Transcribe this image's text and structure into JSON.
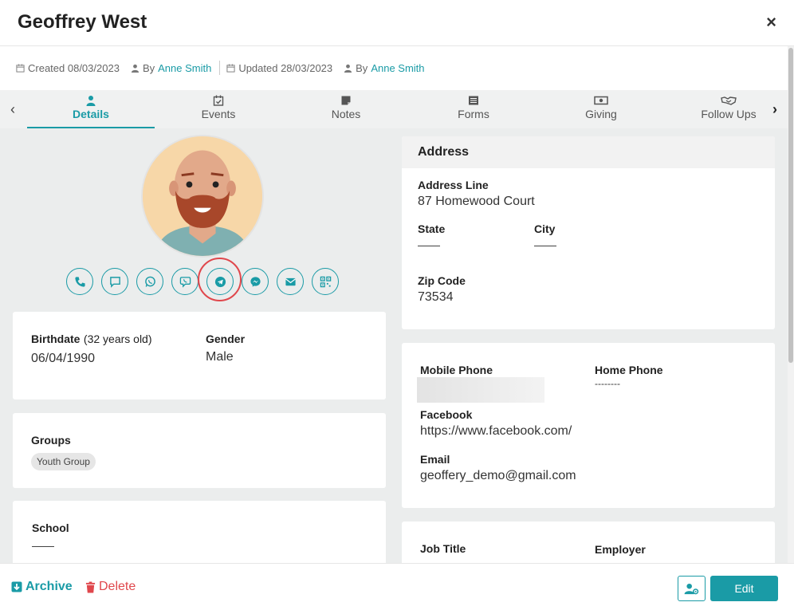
{
  "header": {
    "title": "Geoffrey West",
    "close_label": "×"
  },
  "meta": {
    "created": "Created 08/03/2023",
    "by1": "By",
    "created_by": "Anne Smith",
    "updated": "Updated 28/03/2023",
    "by2": "By",
    "updated_by": "Anne Smith"
  },
  "tabs": [
    {
      "label": "Details",
      "icon": "user-icon"
    },
    {
      "label": "Events",
      "icon": "calendar-check-icon"
    },
    {
      "label": "Notes",
      "icon": "note-icon"
    },
    {
      "label": "Forms",
      "icon": "list-icon"
    },
    {
      "label": "Giving",
      "icon": "money-icon"
    },
    {
      "label": "Follow Ups",
      "icon": "handshake-icon"
    }
  ],
  "contact_buttons": [
    "phone-icon",
    "chat-icon",
    "whatsapp-icon",
    "viber-icon",
    "telegram-icon",
    "messenger-icon",
    "email-icon",
    "qr-code-icon"
  ],
  "personal": {
    "birthdate_label": "Birthdate",
    "age": "(32 years old)",
    "birthdate": "06/04/1990",
    "gender_label": "Gender",
    "gender": "Male"
  },
  "groups": {
    "label": "Groups",
    "items": [
      "Youth Group"
    ]
  },
  "school": {
    "label": "School",
    "value": "——"
  },
  "address": {
    "heading": "Address",
    "line_label": "Address Line",
    "line": "87 Homewood Court",
    "state_label": "State",
    "state": "——",
    "city_label": "City",
    "city": "——",
    "zip_label": "Zip Code",
    "zip": "73534"
  },
  "contact": {
    "mobile_label": "Mobile Phone",
    "home_label": "Home Phone",
    "home": "--------",
    "facebook_label": "Facebook",
    "facebook": "https://www.facebook.com/",
    "email_label": "Email",
    "email": "geoffery_demo@gmail.com"
  },
  "work": {
    "job_label": "Job Title",
    "employer_label": "Employer"
  },
  "footer": {
    "archive": "Archive",
    "delete": "Delete",
    "edit": "Edit"
  },
  "colors": {
    "accent": "#1a9ba6",
    "danger": "#e0474c"
  }
}
